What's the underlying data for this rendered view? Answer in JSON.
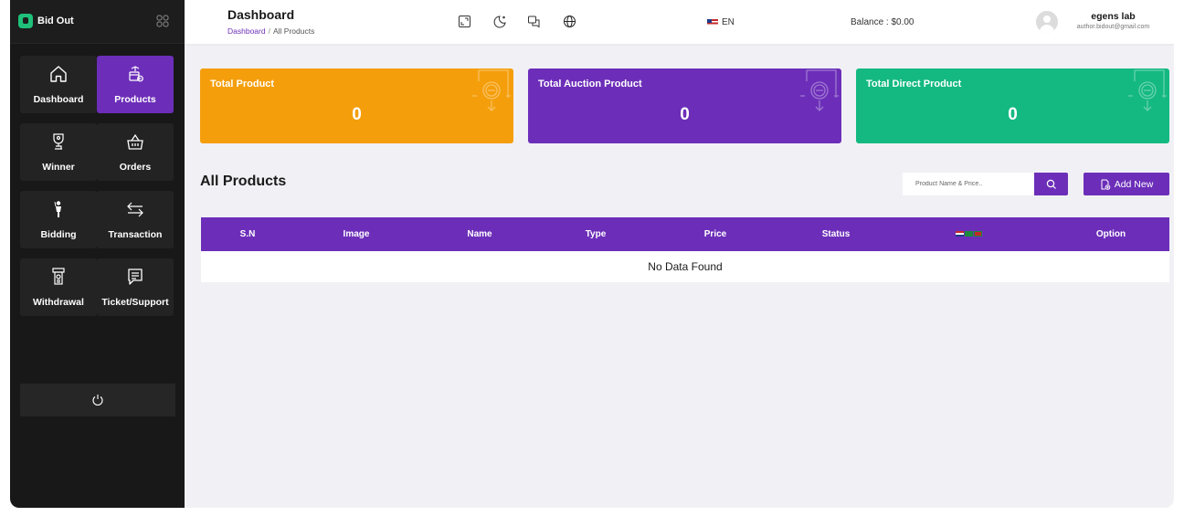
{
  "brand": {
    "name": "Bid Out"
  },
  "sidebar": {
    "items": [
      {
        "label": "Dashboard",
        "icon": "home-icon",
        "active": false
      },
      {
        "label": "Products",
        "icon": "products-box-icon",
        "active": true
      },
      {
        "label": "Winner",
        "icon": "trophy-icon",
        "active": false
      },
      {
        "label": "Orders",
        "icon": "basket-icon",
        "active": false
      },
      {
        "label": "Bidding",
        "icon": "bidding-person-icon",
        "active": false
      },
      {
        "label": "Transaction",
        "icon": "transfer-arrows-icon",
        "active": false
      },
      {
        "label": "Withdrawal",
        "icon": "atm-withdraw-icon",
        "active": false
      },
      {
        "label": "Ticket/Support",
        "icon": "ticket-message-icon",
        "active": false
      }
    ],
    "logout_icon": "power-icon"
  },
  "header": {
    "title": "Dashboard",
    "breadcrumb": {
      "link": "Dashboard",
      "separator": "/",
      "current": "All Products"
    },
    "icons": [
      "fullscreen-icon",
      "theme-toggle-icon",
      "messages-icon",
      "globe-icon"
    ],
    "language": "EN",
    "balance": "Balance : $0.00",
    "user": {
      "name": "egens lab",
      "email": "author.bidout@gmail.com"
    }
  },
  "stats": [
    {
      "title": "Total Product",
      "value": "0",
      "color": "#f59e0b"
    },
    {
      "title": "Total Auction Product",
      "value": "0",
      "color": "#6c2eb9"
    },
    {
      "title": "Total Direct Product",
      "value": "0",
      "color": "#14b981"
    }
  ],
  "products": {
    "title": "All Products",
    "search_placeholder": "Product Name & Price..",
    "add_label": "Add New",
    "columns": [
      "S.N",
      "Image",
      "Name",
      "Type",
      "Price",
      "Status",
      "",
      "Option"
    ],
    "empty_text": "No Data Found"
  },
  "colors": {
    "primary": "#6c2eb9",
    "sidebar": "#181818",
    "background": "#f1f1f5"
  }
}
